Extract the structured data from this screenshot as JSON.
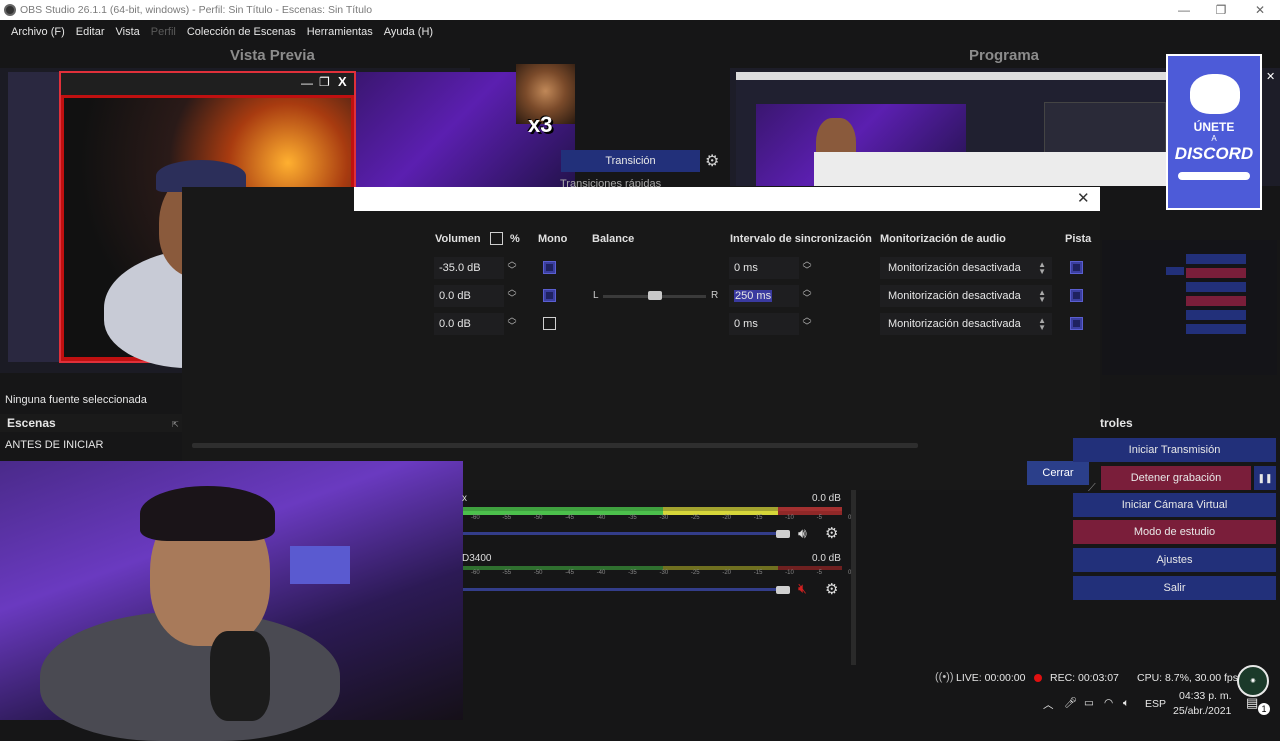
{
  "window": {
    "title": "OBS Studio 26.1.1 (64-bit, windows) - Perfil: Sin Título - Escenas: Sin Título"
  },
  "menu": [
    "Archivo (F)",
    "Editar",
    "Vista",
    "Perfil",
    "Colección de Escenas",
    "Herramientas",
    "Ayuda (H)"
  ],
  "panels": {
    "preview": "Vista Previa",
    "program": "Programa"
  },
  "overlay": {
    "x3": "x3",
    "discord_top": "ÚNETE",
    "discord_small": "A",
    "discord_word": "DISCORD"
  },
  "transition": {
    "label": "Transición",
    "quick": "Transiciones rápidas"
  },
  "dialog": {
    "headers": {
      "volume": "Volumen",
      "percent": "%",
      "mono": "Mono",
      "balance": "Balance",
      "sync": "Intervalo de sincronización",
      "monitor": "Monitorización de audio",
      "tracks": "Pista"
    },
    "rows": [
      {
        "volume": "-35.0 dB",
        "mono": true,
        "sync": "0 ms",
        "monitor": "Monitorización desactivada"
      },
      {
        "volume": "0.0 dB",
        "mono": true,
        "sync": "250 ms",
        "monitor": "Monitorización desactivada"
      },
      {
        "volume": "0.0 dB",
        "mono": false,
        "sync": "0 ms",
        "monitor": "Monitorización desactivada"
      }
    ],
    "balance": {
      "left": "L",
      "right": "R",
      "position": 0.5
    },
    "close": "Cerrar"
  },
  "sources": {
    "none_selected": "Ninguna fuente seleccionada"
  },
  "scenes": {
    "title": "Escenas",
    "items": [
      "ANTES DE INICIAR"
    ]
  },
  "mixer": {
    "tracks": [
      {
        "name": "x",
        "level": "0.0 dB"
      },
      {
        "name": "D3400",
        "level": "0.0 dB"
      }
    ],
    "scale": [
      "-60",
      "-55",
      "-50",
      "-45",
      "-40",
      "-35",
      "-30",
      "-25",
      "-20",
      "-15",
      "-10",
      "-5",
      "0"
    ]
  },
  "controls": {
    "title": "troles",
    "start_stream": "Iniciar Transmisión",
    "stop_recording": "Detener grabación",
    "pause": "❚❚",
    "start_virtual_cam": "Iniciar Cámara Virtual",
    "studio_mode": "Modo de estudio",
    "settings": "Ajustes",
    "exit": "Salir"
  },
  "status": {
    "live": "LIVE: 00:00:00",
    "rec": "REC: 00:03:07",
    "cpu": "CPU: 8.7%, 30.00 fps"
  },
  "taskbar": {
    "lang": "ESP",
    "time": "04:33 p. m.",
    "date": "25/abr./2021",
    "notifications": "1"
  },
  "colors": {
    "accent_blue": "#22307a",
    "accent_red": "#7a1e3a",
    "rec_dot": "#e01010"
  }
}
